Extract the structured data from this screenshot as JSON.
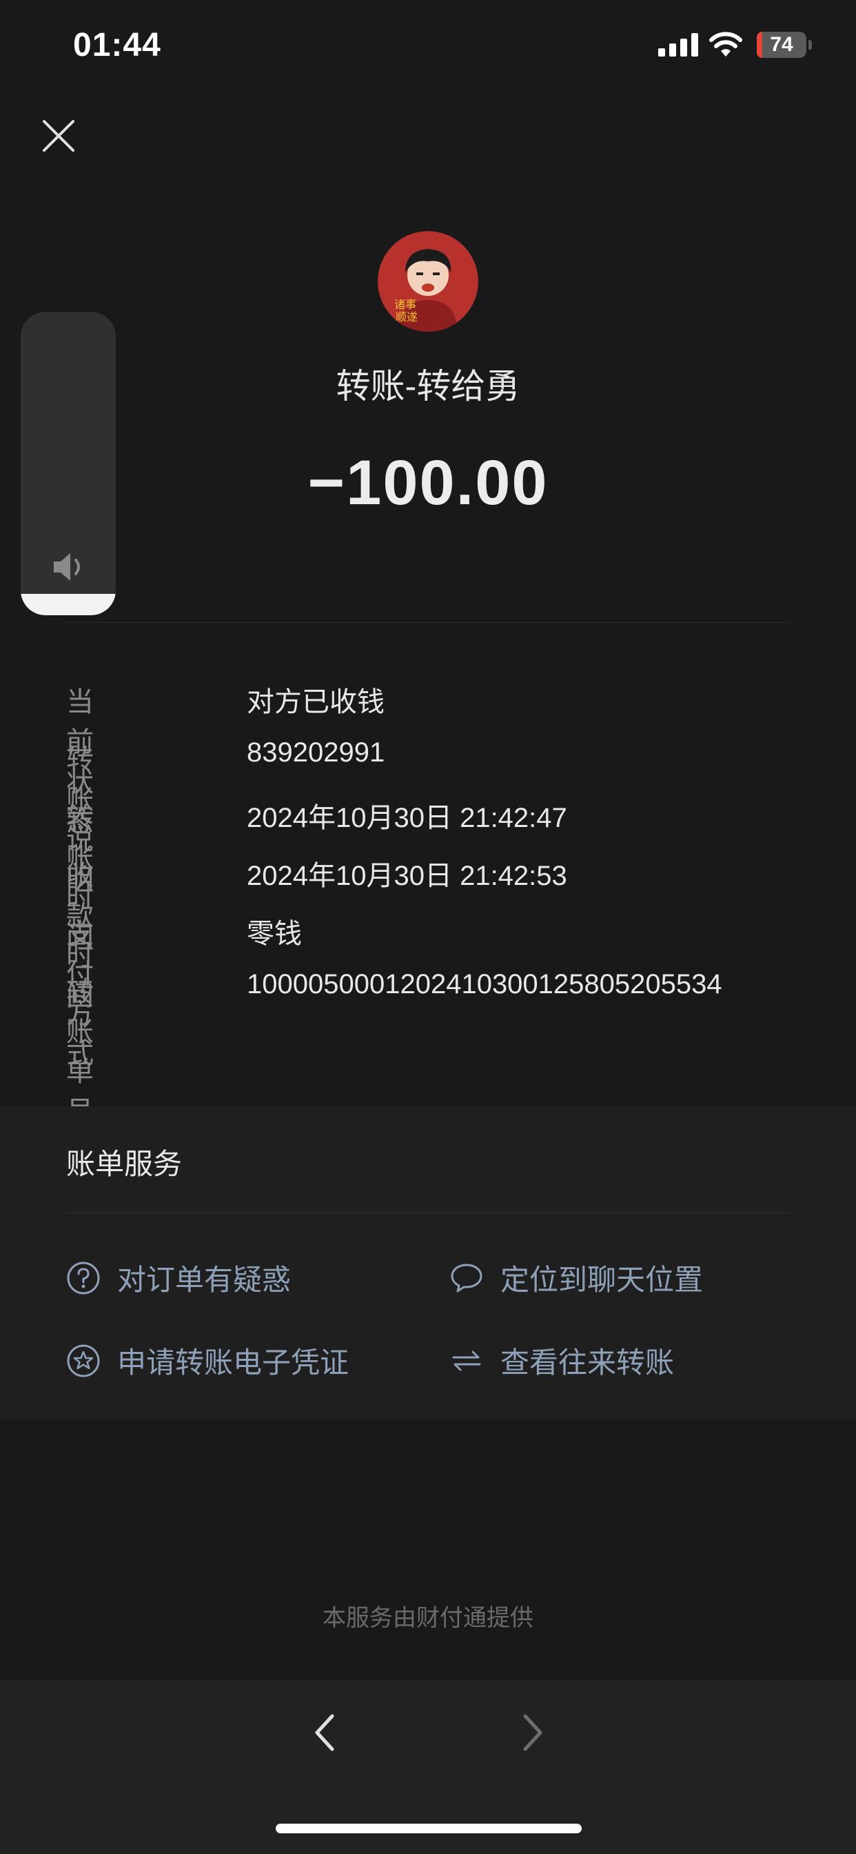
{
  "status_bar": {
    "time": "01:44",
    "battery": "74"
  },
  "transfer": {
    "title": "转账-转给勇",
    "amount": "−100.00"
  },
  "volume_level": 0.07,
  "details": [
    {
      "label": "当前状态",
      "value": "对方已收钱"
    },
    {
      "label": "转账说明",
      "value": "839202991"
    },
    {
      "label": "转账时间",
      "value": "2024年10月30日 21:42:47"
    },
    {
      "label": "收款时间",
      "value": "2024年10月30日 21:42:53"
    },
    {
      "label": "支付方式",
      "value": "零钱"
    },
    {
      "label": "转账单号",
      "value": "100005000120241030012580520553​4"
    }
  ],
  "services": {
    "title": "账单服务",
    "items": [
      {
        "label": "对订单有疑惑",
        "icon": "question-circle-icon"
      },
      {
        "label": "定位到聊天位置",
        "icon": "chat-bubble-icon"
      },
      {
        "label": "申请转账电子凭证",
        "icon": "star-badge-icon"
      },
      {
        "label": "查看往来转账",
        "icon": "swap-arrows-icon"
      }
    ]
  },
  "footer": {
    "text": "本服务由财付通提供"
  },
  "colors": {
    "background": "#191919",
    "link": "#8fa1b8",
    "battery_low": "#e5483b"
  }
}
